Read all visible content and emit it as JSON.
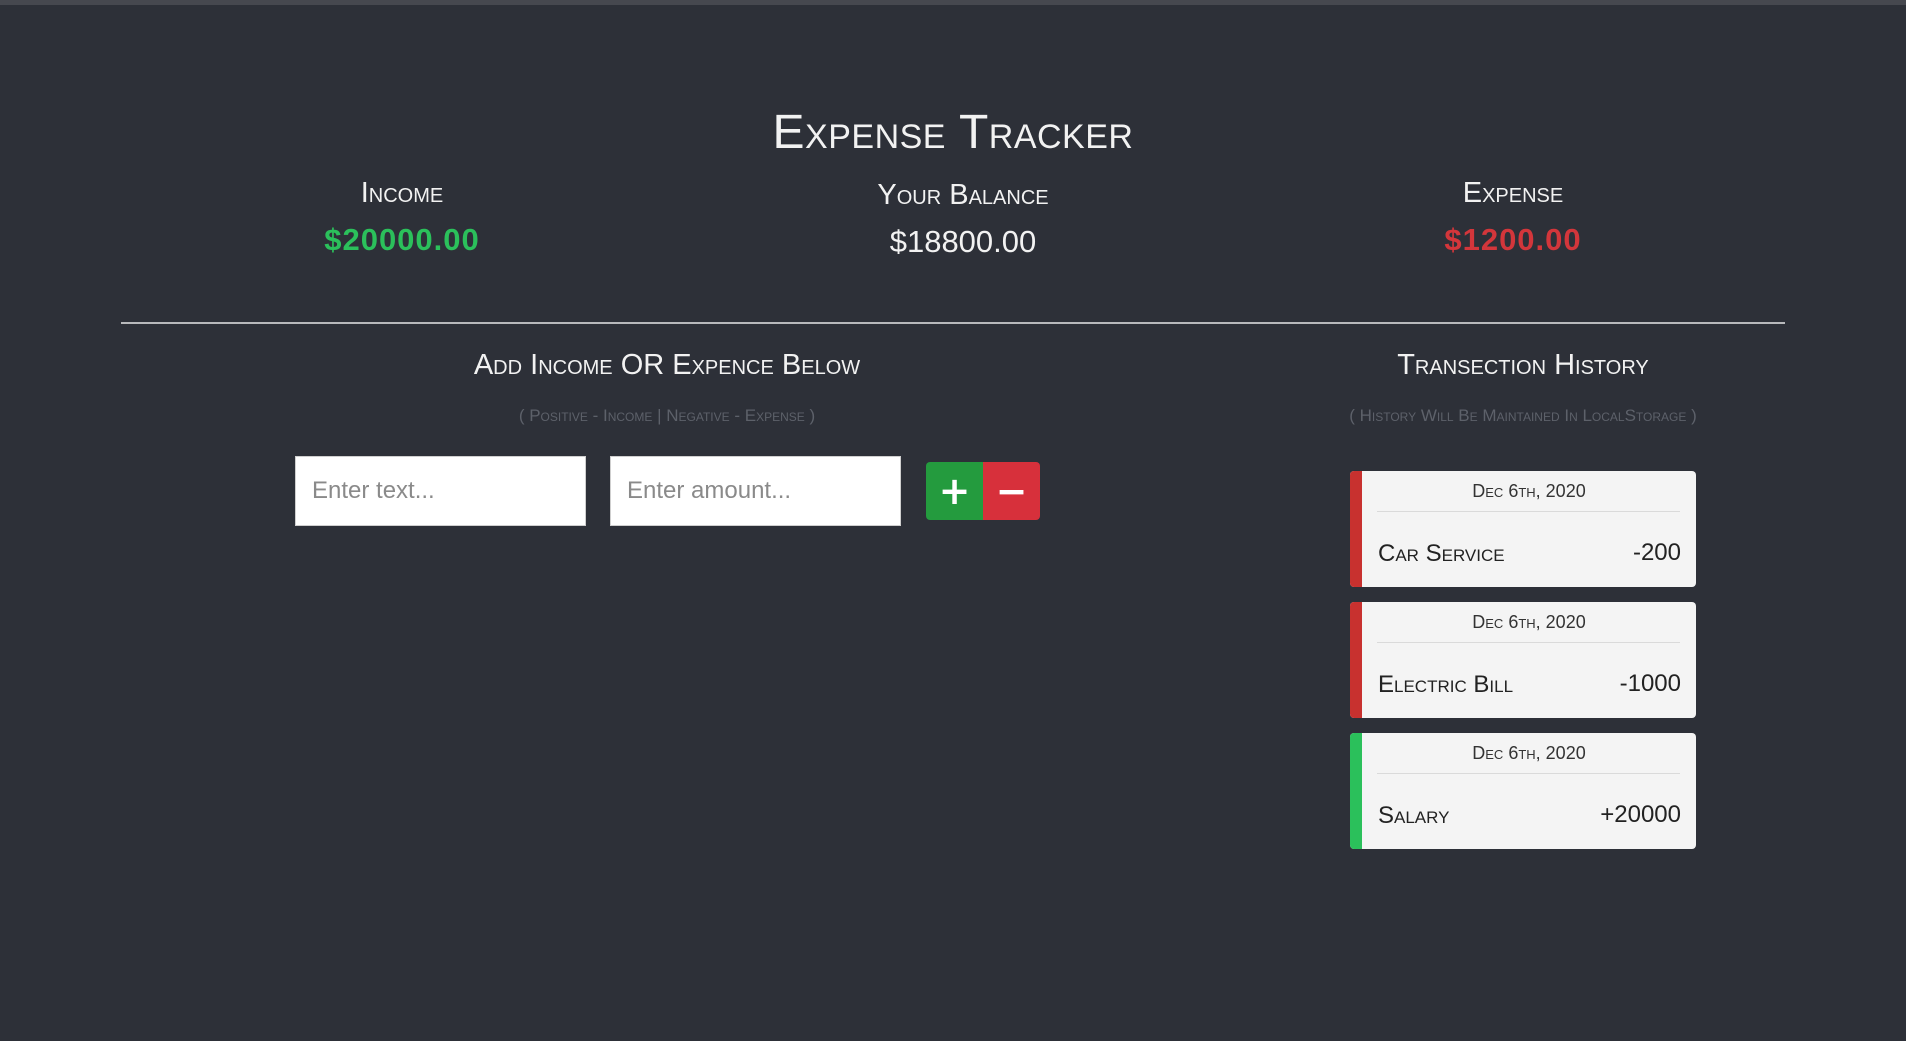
{
  "header": {
    "title": "Expense Tracker"
  },
  "summary": {
    "income_label": "Income",
    "income_value": "$20000.00",
    "balance_label": "Your Balance",
    "balance_value": "$18800.00",
    "expense_label": "Expense",
    "expense_value": "$1200.00"
  },
  "add_section": {
    "title": "Add Income OR Expence Below",
    "subtitle": "( Positive - Income | Negative - Expense )",
    "text_placeholder": "Enter text...",
    "amount_placeholder": "Enter amount...",
    "plus_label": "+",
    "minus_label": "−"
  },
  "history": {
    "title": "Transection History",
    "subtitle": "( History Will Be Maintained In LocalStorage )",
    "transactions": [
      {
        "date": "Dec 6th, 2020",
        "name": "Car Service",
        "amount": "-200"
      },
      {
        "date": "Dec 6th, 2020",
        "name": "Electric Bill",
        "amount": "-1000"
      },
      {
        "date": "Dec 6th, 2020",
        "name": "Salary",
        "amount": "+20000"
      }
    ]
  },
  "colors": {
    "background": "#2d3038",
    "income": "#2bc05b",
    "expense": "#d3363b",
    "plus_button": "#249b3e",
    "minus_button": "#d7303b"
  }
}
